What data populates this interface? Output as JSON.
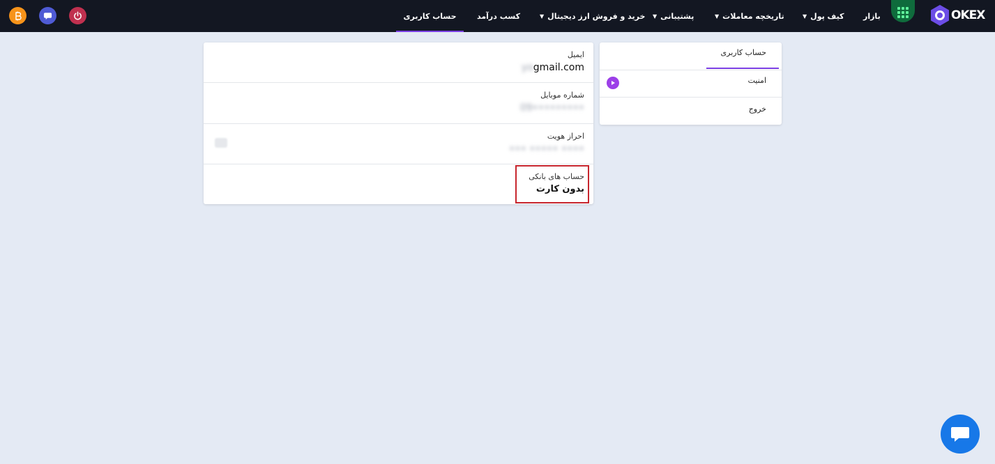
{
  "brand": {
    "logo_text": "OKEX",
    "accent": "#7b3fe4",
    "topbar_bg": "#131722",
    "page_bg": "#e4eaf4"
  },
  "nav": {
    "market": "بازار",
    "wallet": "کیف پول",
    "history": "تاریخچه معاملات",
    "support": "پشتیبانی",
    "buy_sell": "خرید و فروش ارز دیجیتال",
    "earn": "کسب درآمد",
    "account": "حساب کاربری"
  },
  "side_menu": {
    "account": "حساب کاربری",
    "security": "امنیت",
    "logout": "خروج"
  },
  "profile": {
    "email_label": "ایمیل",
    "email_value_visible": "gmail.com",
    "email_value_blurred": "yo",
    "mobile_label": "شماره موبایل",
    "mobile_value": "09•••••••••",
    "kyc_label": "احراز هویت",
    "kyc_value": "••• ••••• ••••",
    "bank_label": "حساب های بانکی",
    "bank_value": "بدون کارت"
  },
  "icons": [
    "grid-icon",
    "power-icon",
    "message-icon",
    "bitcoin-icon",
    "play-icon",
    "chat-icon",
    "hexagon-logo-icon"
  ],
  "colors": {
    "power": "#c0304f",
    "message": "#4f5bd5",
    "bitcoin": "#f7931a",
    "chat": "#1778e8",
    "highlight": "#c7262e"
  }
}
